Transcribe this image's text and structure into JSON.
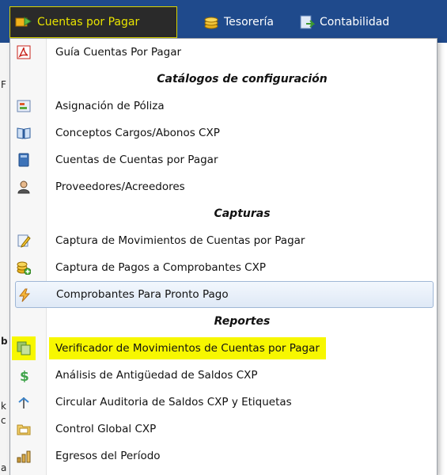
{
  "menubar": {
    "items": [
      {
        "label": "Cuentas por Pagar",
        "icon": "payables-icon",
        "active": true
      },
      {
        "label": "Tesorería",
        "icon": "treasury-icon",
        "active": false
      },
      {
        "label": "Contabilidad",
        "icon": "accounting-icon",
        "active": false
      }
    ]
  },
  "left_edge_chars": [
    "F",
    "b",
    "",
    "k",
    "c",
    "a"
  ],
  "dropdown": {
    "guide": {
      "label": "Guía Cuentas Por Pagar",
      "icon": "pdf-icon"
    },
    "sections": {
      "config": "Catálogos de configuración",
      "captures": "Capturas",
      "reports": "Reportes"
    },
    "config_items": [
      {
        "label": "Asignación de Póliza",
        "icon": "policy-assignment-icon"
      },
      {
        "label": "Conceptos Cargos/Abonos CXP",
        "icon": "book-icon"
      },
      {
        "label": "Cuentas de Cuentas por Pagar",
        "icon": "ledger-icon"
      },
      {
        "label": "Proveedores/Acreedores",
        "icon": "supplier-icon"
      }
    ],
    "capture_items": [
      {
        "label": "Captura de Movimientos de Cuentas por Pagar",
        "icon": "edit-document-icon"
      },
      {
        "label": "Captura de Pagos a Comprobantes CXP",
        "icon": "coins-add-icon"
      },
      {
        "label": "Comprobantes Para Pronto Pago",
        "icon": "lightning-icon",
        "highlight": "hover"
      }
    ],
    "report_items": [
      {
        "label": "Verificador de Movimientos de Cuentas por Pagar",
        "icon": "copy-documents-icon",
        "highlight": "yellow"
      },
      {
        "label": "Análisis de Antigüedad de Saldos CXP",
        "icon": "dollar-icon"
      },
      {
        "label": "Circular Auditoria de Saldos CXP y Etiquetas",
        "icon": "signpost-icon"
      },
      {
        "label": "Control Global CXP",
        "icon": "folder-icon"
      },
      {
        "label": "Egresos del Período",
        "icon": "chart-stack-icon"
      }
    ]
  },
  "colors": {
    "menubar_bg": "#1f4a8c",
    "active_text": "#e9e400",
    "yellow_highlight": "#f7f700",
    "hover_border": "#9fb7d6"
  }
}
